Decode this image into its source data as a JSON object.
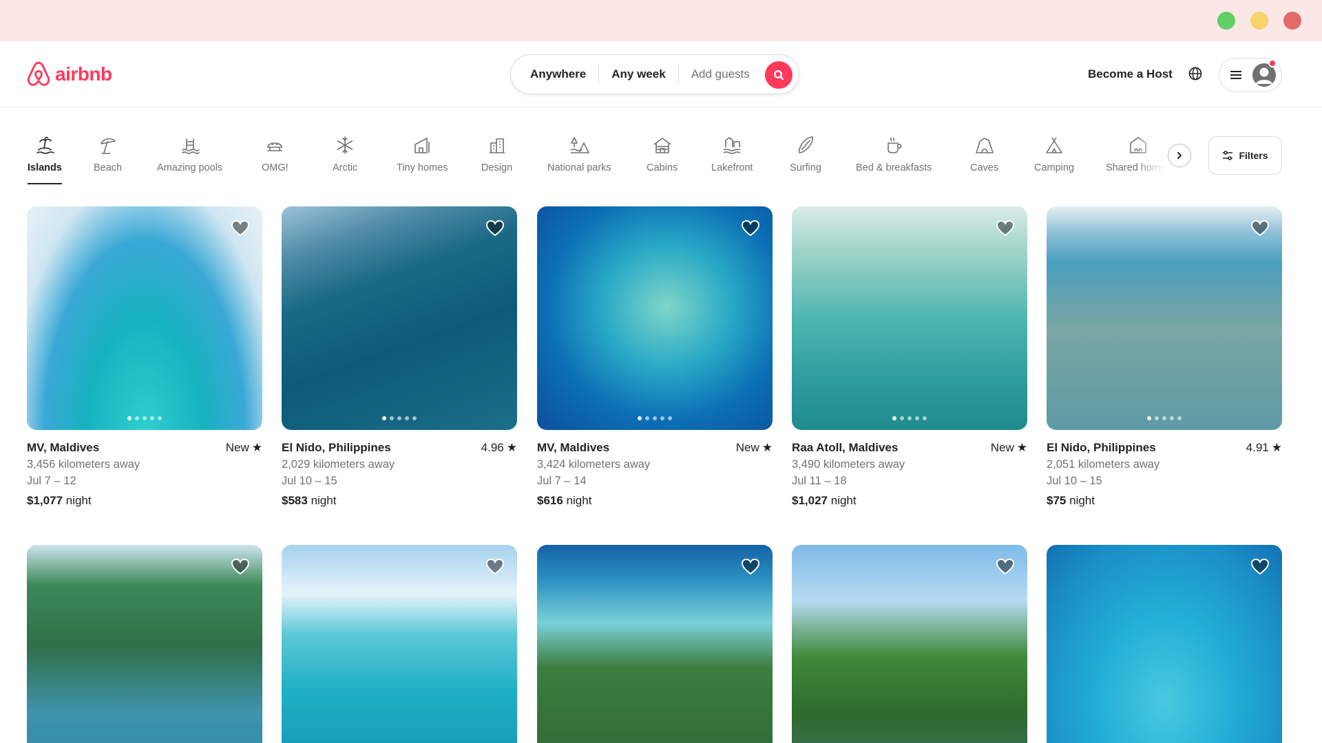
{
  "window": {
    "controls": [
      "green",
      "yellow",
      "red"
    ],
    "colors": {
      "green": "#5fcf66",
      "yellow": "#f7d46b",
      "red": "#e36a6a",
      "bar": "#fbe7e6"
    }
  },
  "header": {
    "logo_text": "airbnb",
    "brand_color": "#ff385c",
    "search": {
      "where": "Anywhere",
      "when": "Any week",
      "who": "Add guests"
    },
    "become_host": "Become a Host",
    "icons": [
      "airbnb-logo-icon",
      "search-icon",
      "globe-icon",
      "menu-icon",
      "user-icon"
    ]
  },
  "categories": {
    "items": [
      {
        "label": "Islands",
        "icon": "islands-icon",
        "active": true
      },
      {
        "label": "Beach",
        "icon": "beach-icon"
      },
      {
        "label": "Amazing pools",
        "icon": "pool-icon"
      },
      {
        "label": "OMG!",
        "icon": "omg-icon"
      },
      {
        "label": "Arctic",
        "icon": "snowflake-icon"
      },
      {
        "label": "Tiny homes",
        "icon": "tiny-home-icon"
      },
      {
        "label": "Design",
        "icon": "design-icon"
      },
      {
        "label": "National parks",
        "icon": "national-park-icon"
      },
      {
        "label": "Cabins",
        "icon": "cabin-icon"
      },
      {
        "label": "Lakefront",
        "icon": "lakefront-icon"
      },
      {
        "label": "Surfing",
        "icon": "surfboard-icon"
      },
      {
        "label": "Bed & breakfasts",
        "icon": "coffee-icon"
      },
      {
        "label": "Caves",
        "icon": "cave-icon"
      },
      {
        "label": "Camping",
        "icon": "camping-icon"
      },
      {
        "label": "Shared homes",
        "icon": "shared-home-icon"
      }
    ],
    "filters_label": "Filters"
  },
  "listings": [
    {
      "location": "MV, Maldives",
      "rating": "New",
      "distance": "3,456 kilometers away",
      "dates": "Jul 7 – 12",
      "price": "$1,077",
      "price_unit": "night"
    },
    {
      "location": "El Nido, Philippines",
      "rating": "4.96",
      "distance": "2,029 kilometers away",
      "dates": "Jul 10 – 15",
      "price": "$583",
      "price_unit": "night"
    },
    {
      "location": "MV, Maldives",
      "rating": "New",
      "distance": "3,424 kilometers away",
      "dates": "Jul 7 – 14",
      "price": "$616",
      "price_unit": "night"
    },
    {
      "location": "Raa Atoll, Maldives",
      "rating": "New",
      "distance": "3,490 kilometers away",
      "dates": "Jul 11 – 18",
      "price": "$1,027",
      "price_unit": "night"
    },
    {
      "location": "El Nido, Philippines",
      "rating": "4.91",
      "distance": "2,051 kilometers away",
      "dates": "Jul 10 – 15",
      "price": "$75",
      "price_unit": "night"
    },
    {
      "location": "",
      "rating": "",
      "distance": "",
      "dates": "",
      "price": "",
      "price_unit": ""
    },
    {
      "location": "",
      "rating": "",
      "distance": "",
      "dates": "",
      "price": "",
      "price_unit": ""
    },
    {
      "location": "",
      "rating": "",
      "distance": "",
      "dates": "",
      "price": "",
      "price_unit": ""
    },
    {
      "location": "",
      "rating": "",
      "distance": "",
      "dates": "",
      "price": "",
      "price_unit": ""
    },
    {
      "location": "",
      "rating": "",
      "distance": "",
      "dates": "",
      "price": "",
      "price_unit": ""
    }
  ]
}
